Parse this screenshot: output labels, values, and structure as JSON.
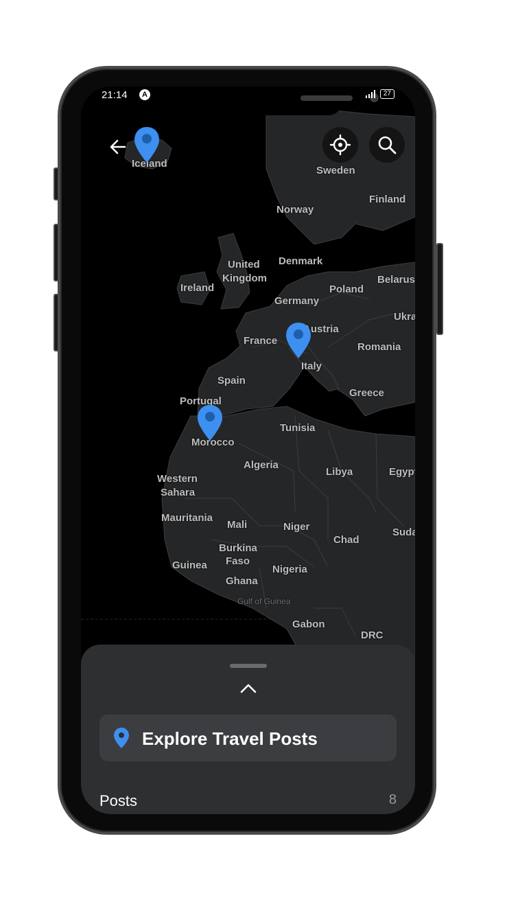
{
  "status_bar": {
    "time": "21:14",
    "app_badge": "A",
    "battery": "27"
  },
  "map": {
    "countries": [
      {
        "name": "Iceland"
      },
      {
        "name": "Sweden"
      },
      {
        "name": "Finland"
      },
      {
        "name": "Norway"
      },
      {
        "name": "United"
      },
      {
        "name": "Kingdom"
      },
      {
        "name": "Denmark"
      },
      {
        "name": "Ireland"
      },
      {
        "name": "Poland"
      },
      {
        "name": "Belarus"
      },
      {
        "name": "Germany"
      },
      {
        "name": "Ukra"
      },
      {
        "name": "Austria"
      },
      {
        "name": "France"
      },
      {
        "name": "Romania"
      },
      {
        "name": "Italy"
      },
      {
        "name": "Spain"
      },
      {
        "name": "Greece"
      },
      {
        "name": "Portugal"
      },
      {
        "name": "Tunisia"
      },
      {
        "name": "Morocco"
      },
      {
        "name": "Algeria"
      },
      {
        "name": "Libya"
      },
      {
        "name": "Egypt"
      },
      {
        "name": "Western"
      },
      {
        "name": "Sahara"
      },
      {
        "name": "Mauritania"
      },
      {
        "name": "Mali"
      },
      {
        "name": "Niger"
      },
      {
        "name": "Chad"
      },
      {
        "name": "Suda"
      },
      {
        "name": "Burkina"
      },
      {
        "name": "Faso"
      },
      {
        "name": "Guinea"
      },
      {
        "name": "Nigeria"
      },
      {
        "name": "Ghana"
      },
      {
        "name": "Gabon"
      },
      {
        "name": "DRC"
      }
    ],
    "water_label": "Gulf of Guinea",
    "pins": [
      {
        "place": "Iceland"
      },
      {
        "place": "Italy"
      },
      {
        "place": "Morocco"
      }
    ],
    "pin_color": "#3d8ff0"
  },
  "sheet": {
    "explore_label": "Explore Travel Posts",
    "posts_label": "Posts",
    "posts_count": "8"
  },
  "colors": {
    "land": "#252628",
    "sea": "#000000",
    "border": "#3c3d40",
    "sheet": "#2e2f31",
    "accent": "#3d8ff0"
  }
}
